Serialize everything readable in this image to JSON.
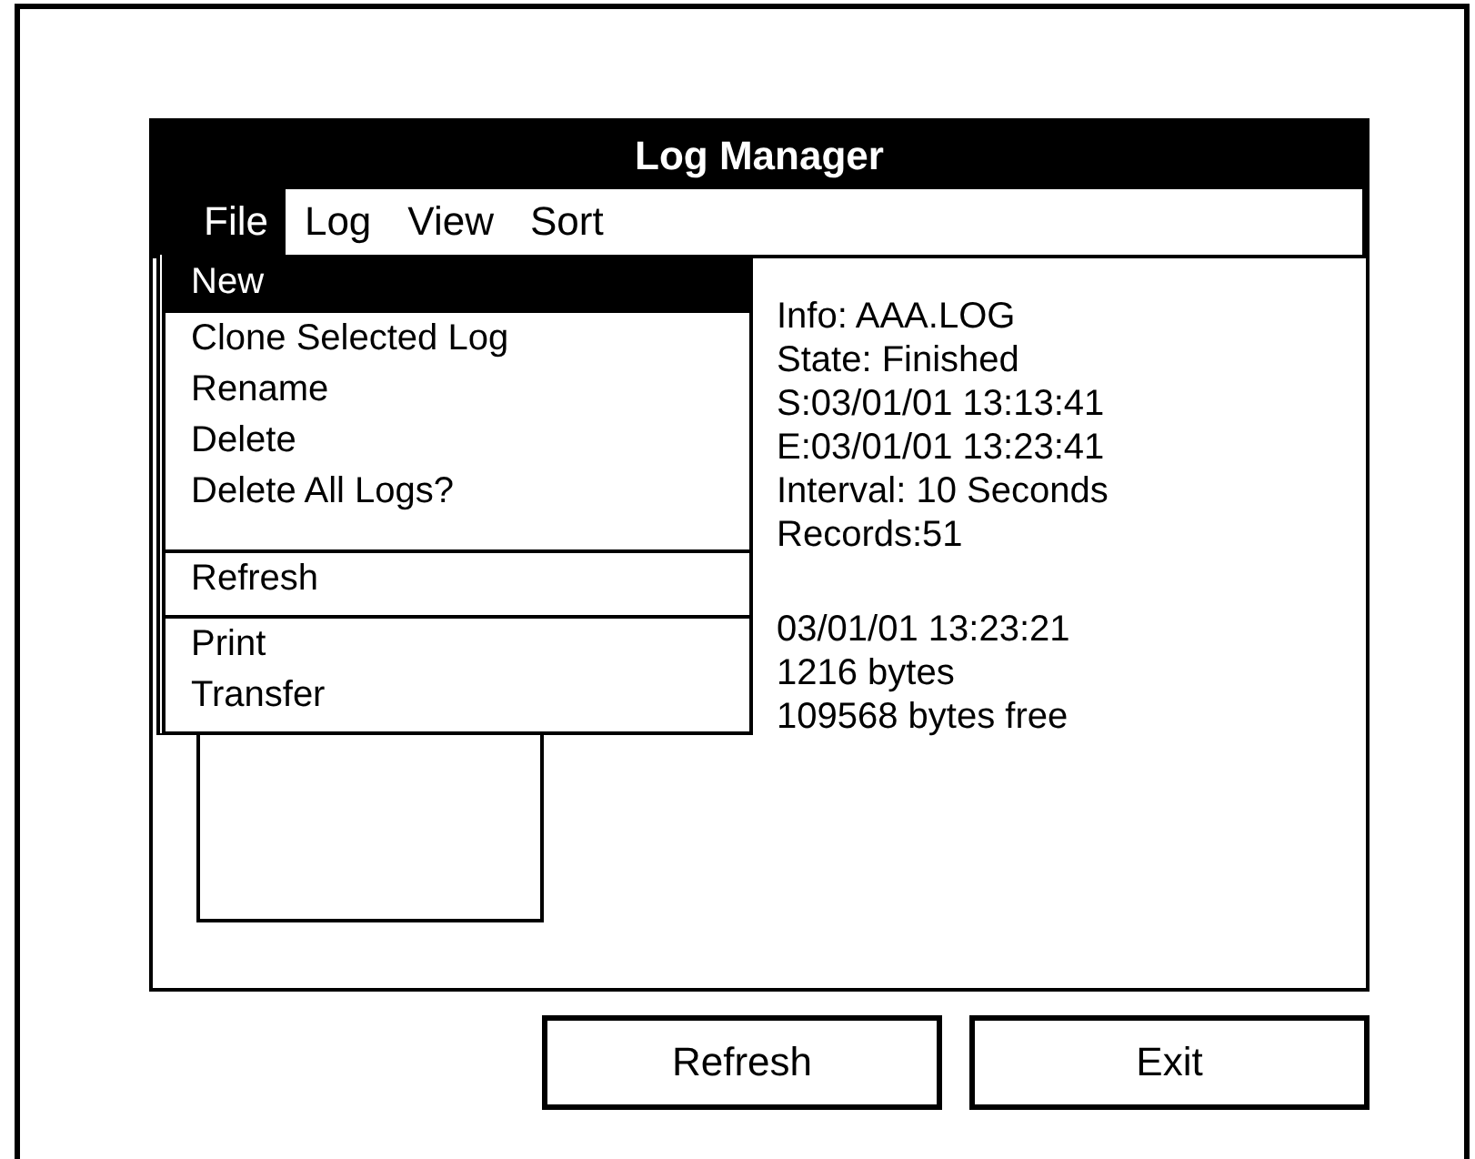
{
  "window": {
    "title": "Log Manager"
  },
  "menus": [
    {
      "label": "File",
      "selected": true
    },
    {
      "label": "Log",
      "selected": false
    },
    {
      "label": "View",
      "selected": false
    },
    {
      "label": "Sort",
      "selected": false
    }
  ],
  "dropdown": {
    "groups": [
      [
        {
          "label": "New",
          "selected": true
        },
        {
          "label": "Clone Selected Log",
          "selected": false
        },
        {
          "label": "Rename",
          "selected": false
        },
        {
          "label": "Delete",
          "selected": false
        },
        {
          "label": "Delete All Logs?",
          "selected": false
        }
      ],
      [
        {
          "label": "Refresh",
          "selected": false
        }
      ],
      [
        {
          "label": "Print",
          "selected": false
        },
        {
          "label": "Transfer",
          "selected": false
        }
      ]
    ]
  },
  "info": [
    "Info: AAA.LOG",
    "State: Finished",
    "S:03/01/01 13:13:41",
    "E:03/01/01 13:23:41",
    "Interval: 10 Seconds",
    "Records:51"
  ],
  "summary": [
    "03/01/01 13:23:21",
    "1216 bytes",
    "109568 bytes free"
  ],
  "buttons": [
    "Refresh",
    "Exit"
  ]
}
